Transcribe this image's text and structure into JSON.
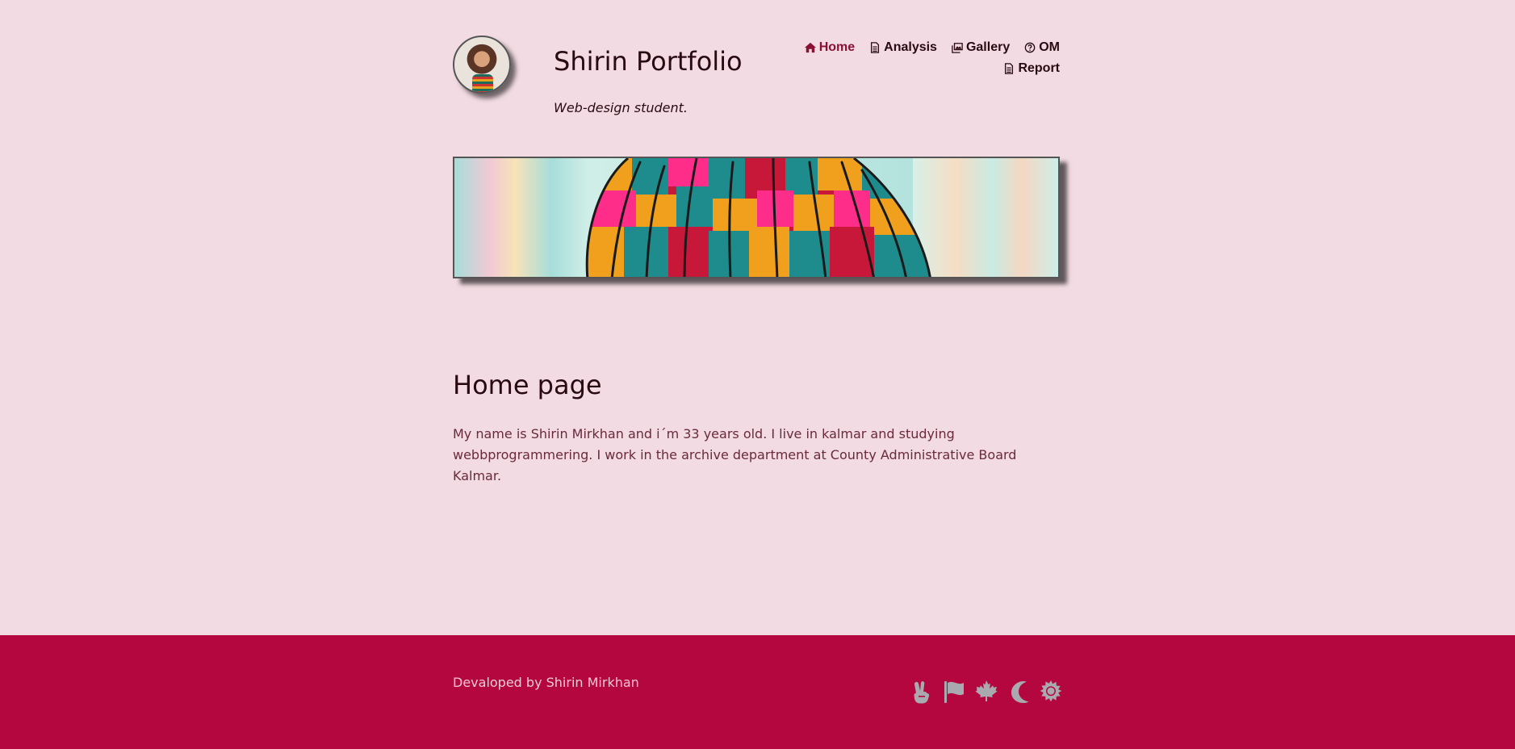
{
  "header": {
    "title": "Shirin Portfolio",
    "tagline": "Web-design student."
  },
  "nav": {
    "home": "Home",
    "analysis": "Analysis",
    "gallery": "Gallery",
    "om": "OM",
    "report": "Report"
  },
  "main": {
    "heading": "Home page",
    "text": "My name is Shirin Mirkhan and i´m 33 years old. I live in kalmar and studying webbprogrammering. I work in the archive department at County Administrative Board Kalmar."
  },
  "footer": {
    "credit": "Devaloped by Shirin Mirkhan",
    "icons": [
      "peace-hand-icon",
      "flag-icon",
      "maple-leaf-icon",
      "moon-icon",
      "sun-icon"
    ]
  },
  "colors": {
    "background": "#f2dbe2",
    "footer": "#b5073f",
    "active_link": "#8a1034"
  }
}
